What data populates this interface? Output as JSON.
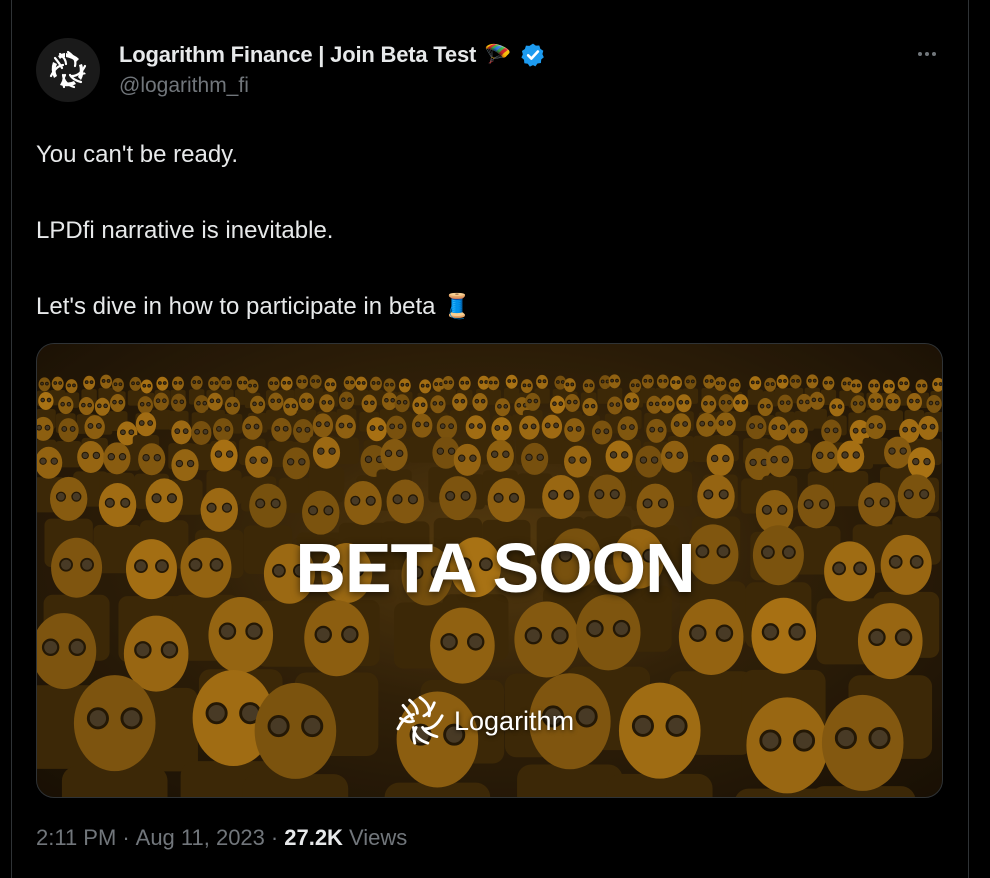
{
  "colors": {
    "background": "#000000",
    "text_primary": "#e7e9ea",
    "text_secondary": "#71767b",
    "verified_blue": "#1d9bf0",
    "media_gold": "#c8901e"
  },
  "author": {
    "display_name": "Logarithm Finance | Join Beta Test",
    "name_emoji": "🪂",
    "verified_icon": "verified-badge-icon",
    "handle": "@logarithm_fi",
    "avatar_icon": "logarithm-logo-icon"
  },
  "more_icon": "more-options-icon",
  "tweet": {
    "line1": "You can't be ready.",
    "line2": "LPDfi narrative is inevitable.",
    "line3": "Let's dive in how to participate in beta",
    "line3_emoji": "🧵"
  },
  "media": {
    "headline": "BETA SOON",
    "brand_name": "Logarithm",
    "brand_icon": "logarithm-logo-icon"
  },
  "meta": {
    "time": "2:11 PM",
    "separator": "·",
    "date": "Aug 11, 2023",
    "views_count": "27.2K",
    "views_label": "Views"
  }
}
